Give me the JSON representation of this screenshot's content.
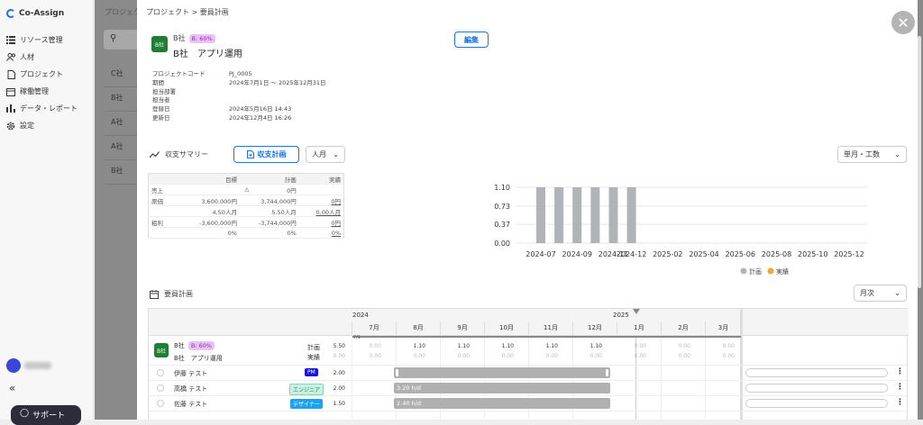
{
  "sidebar": {
    "brand": "Co-Assign",
    "items": [
      {
        "label": "リソース管理",
        "icon": "list-icon"
      },
      {
        "label": "人材",
        "icon": "people-icon"
      },
      {
        "label": "プロジェクト",
        "icon": "document-icon"
      },
      {
        "label": "稼働管理",
        "icon": "calendar-icon"
      },
      {
        "label": "データ・レポート",
        "icon": "bar-chart-icon"
      },
      {
        "label": "設定",
        "icon": "gear-icon"
      }
    ],
    "collapse": "«",
    "support": "サポート"
  },
  "background": {
    "breadcrumb": "プロジェク",
    "rows": [
      "C社",
      "B社",
      "A社",
      "A社",
      "B社"
    ]
  },
  "panel": {
    "breadcrumb": "プロジェクト > 要員計画",
    "badge": "B社",
    "client": "B社",
    "tag": "B: 60%",
    "project_name": "B社　アプリ運用",
    "edit_label": "編集",
    "info": [
      {
        "k": "プロジェクトコード",
        "v": "PJ_0005"
      },
      {
        "k": "期間",
        "v": "2024年7月1日 ～ 2025年12月31日"
      },
      {
        "k": "担当部署",
        "v": ""
      },
      {
        "k": "担当者",
        "v": ""
      },
      {
        "k": "登録日",
        "v": "2024年5月16日 14:43"
      },
      {
        "k": "更新日",
        "v": "2024年12月4日 16:26"
      }
    ],
    "summary_title": "収支サマリー",
    "summary_button": "収支計画",
    "unit_select": "人月",
    "range_select": "単月・工数",
    "table": {
      "headers": [
        "目標",
        "計画",
        "実績"
      ],
      "rows": [
        {
          "label": "売上",
          "target": "",
          "plan": "0円",
          "actual": ""
        },
        {
          "label": "原価",
          "target": "3,600,000円",
          "plan": "3,744,000円",
          "actual": "0円"
        },
        {
          "label": "",
          "target": "4.50人月",
          "plan": "5.50人月",
          "actual": "0.00人月"
        },
        {
          "label": "粗利",
          "target": "-3,600,000円",
          "plan": "-3,744,000円",
          "actual": "0円"
        },
        {
          "label": "",
          "target": "0%",
          "plan": "0%",
          "actual": "0%"
        }
      ]
    },
    "staffing_title": "要員計画",
    "view_select": "月次"
  },
  "chart_data": {
    "type": "bar",
    "x": [
      "2024-07",
      "2024-08",
      "2024-09",
      "2024-10",
      "2024-11",
      "2024-12"
    ],
    "series": [
      {
        "name": "計画",
        "color": "#b0b4b8",
        "values": [
          1.1,
          1.1,
          1.1,
          1.1,
          1.1,
          1.1
        ]
      },
      {
        "name": "実績",
        "color": "#f0a830",
        "values": [
          0,
          0,
          0,
          0,
          0,
          0
        ]
      }
    ],
    "xticks": [
      "2024-07",
      "2024-09",
      "2024-11",
      "2024-12",
      "2025-02",
      "2025-04",
      "2025-06",
      "2025-08",
      "2025-10",
      "2025-12"
    ],
    "yticks": [
      "0.00",
      "0.37",
      "0.73",
      "1.10"
    ],
    "ylim": [
      0,
      1.1
    ]
  },
  "schedule": {
    "years": [
      "2024",
      "2025"
    ],
    "months": [
      "7月",
      "8月",
      "9月",
      "10月",
      "11月",
      "12月",
      "1月",
      "2月",
      "3月"
    ],
    "header_marker": "7/1",
    "project_row": {
      "badge": "B社",
      "client": "B社",
      "tag": "B: 60%",
      "name": "B社　アプリ運用",
      "plan_label": "計画",
      "actual_label": "実績",
      "total_plan": "5.50",
      "total_actual": "0.00",
      "plan_values": [
        "0.00",
        "1.10",
        "1.10",
        "1.10",
        "1.10",
        "1.10",
        "0.00",
        "0.00",
        "0.00"
      ],
      "actual_values": [
        "0.00",
        "0.00",
        "0.00",
        "0.00",
        "0.00",
        "0.00",
        "0.00",
        "0.00",
        "0.00"
      ]
    },
    "members": [
      {
        "name": "伊藤 テスト",
        "role": "PM",
        "role_bg": "#1414d4",
        "role_fg": "#ffffff",
        "total": "2.00",
        "bar": ""
      },
      {
        "name": "高橋 テスト",
        "role": "エンジニア",
        "role_bg": "#c8f0e0",
        "role_fg": "#1a8a60",
        "total": "2.00",
        "bar": "3.20 h/d"
      },
      {
        "name": "佐藤 テスト",
        "role": "デザイナー",
        "role_bg": "#1aa3f0",
        "role_fg": "#ffffff",
        "total": "1.50",
        "bar": "2.40 h/d"
      }
    ]
  }
}
